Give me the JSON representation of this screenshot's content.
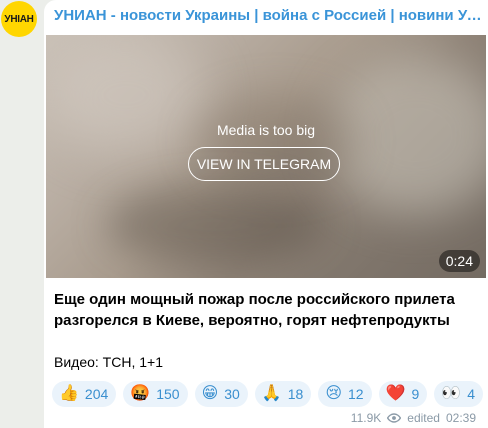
{
  "channel": {
    "avatar_text": "УНІАН",
    "name": "УНИАН - новости Украины | война с Россией | новини України | війна з Росією"
  },
  "media": {
    "notice": "Media is too big",
    "button_label": "VIEW IN TELEGRAM",
    "duration": "0:24"
  },
  "post": {
    "text": "Еще один мощный пожар после российского прилета разгорелся в Киеве, вероятно, горят нефтепродукты",
    "credit": "Видео: ТСН, 1+1"
  },
  "reactions": [
    {
      "emoji": "👍",
      "icon": "thumbs-up-icon",
      "count": "204"
    },
    {
      "emoji": "🤬",
      "icon": "cursing-face-icon",
      "count": "150"
    },
    {
      "emoji": "😁",
      "icon": "grinning-face-icon",
      "count": "30"
    },
    {
      "emoji": "🙏",
      "icon": "folded-hands-icon",
      "count": "18"
    },
    {
      "emoji": "😢",
      "icon": "crying-face-icon",
      "count": "12"
    },
    {
      "emoji": "❤️",
      "icon": "red-heart-icon",
      "count": "9"
    },
    {
      "emoji": "👀",
      "icon": "eyes-icon",
      "count": "4"
    }
  ],
  "meta": {
    "views": "11.9K",
    "edited_label": "edited",
    "time": "02:39"
  },
  "colors": {
    "accent": "#3a94d8",
    "avatar_bg": "#ffd600",
    "reaction_bg": "#eaf3fb",
    "page_bg": "#eceeea"
  }
}
